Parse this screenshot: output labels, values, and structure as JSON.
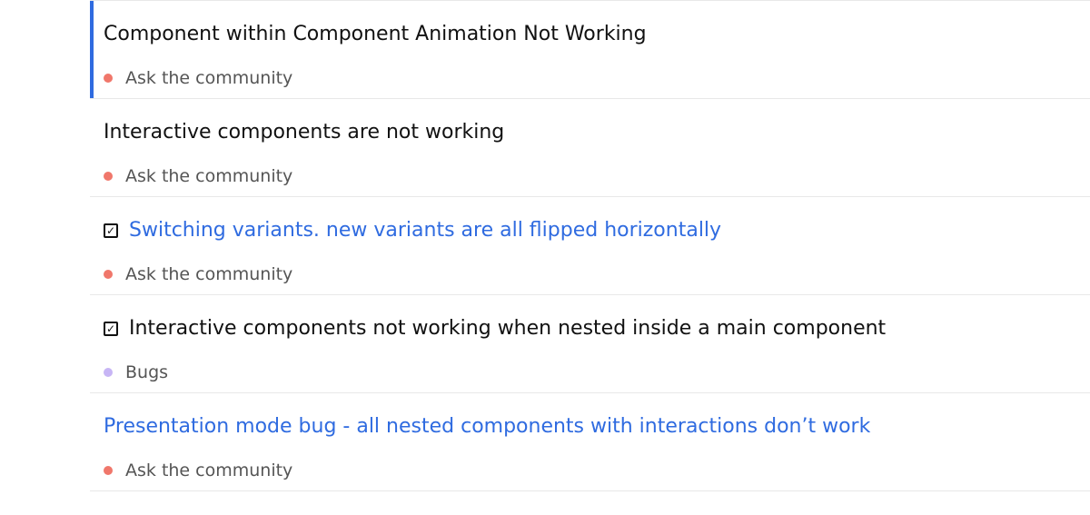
{
  "topics": [
    {
      "title": "Component within Component Animation Not Working",
      "category": "Ask the community",
      "category_color": "#f0776b",
      "active": true,
      "checked": false,
      "link": false
    },
    {
      "title": "Interactive components are not working",
      "category": "Ask the community",
      "category_color": "#f0776b",
      "active": false,
      "checked": false,
      "link": false
    },
    {
      "title": "Switching variants. new variants are all flipped horizontally",
      "category": "Ask the community",
      "category_color": "#f0776b",
      "active": false,
      "checked": true,
      "link": true
    },
    {
      "title": "Interactive components not working when nested inside a main component",
      "category": "Bugs",
      "category_color": "#c7b5f5",
      "active": false,
      "checked": true,
      "link": false
    },
    {
      "title": "Presentation mode bug - all nested components with interactions don’t work",
      "category": "Ask the community",
      "category_color": "#f0776b",
      "active": false,
      "checked": false,
      "link": true
    }
  ],
  "colors": {
    "accent": "#2f6be0",
    "divider": "#e8e8e8",
    "title_text": "#111111",
    "category_text": "#555555"
  },
  "icons": {
    "checked": "checkbox-checked-icon",
    "category": "category-dot-icon"
  }
}
